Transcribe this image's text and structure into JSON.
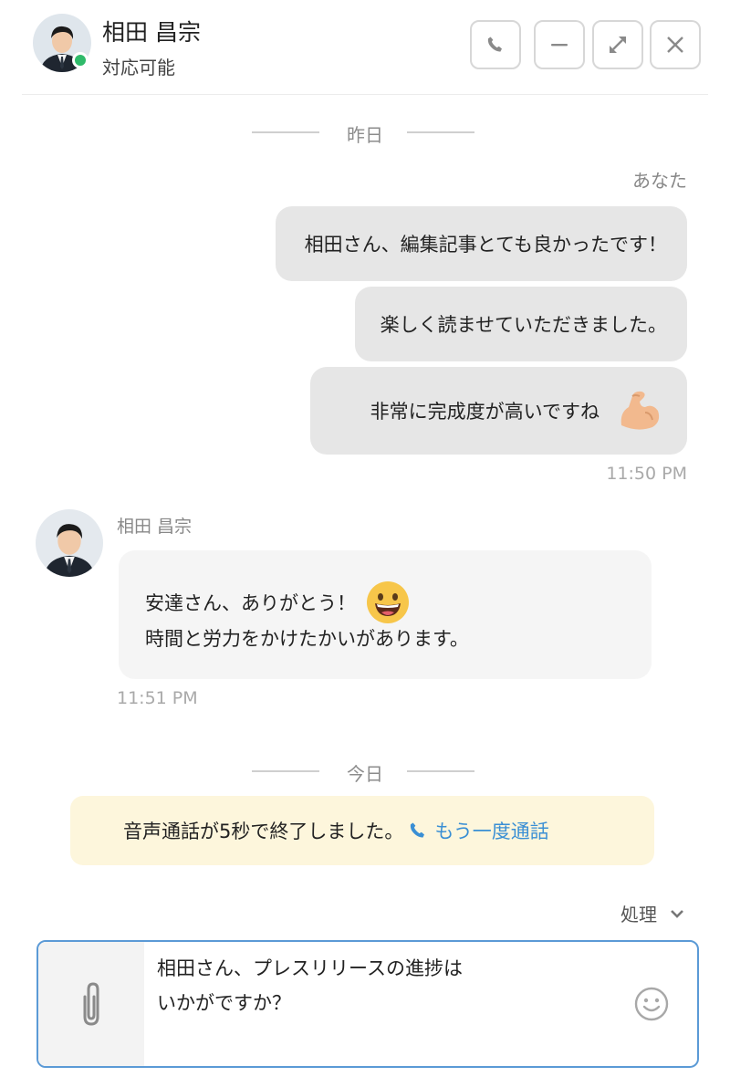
{
  "header": {
    "contact_name": "相田 昌宗",
    "contact_status": "対応可能",
    "buttons": [
      "phone-icon",
      "minimize-icon",
      "expand-icon",
      "close-icon"
    ],
    "status_color": "#2fba6a"
  },
  "separators": {
    "yesterday": "昨日",
    "today": "今日"
  },
  "outgoing": {
    "sender": "あなた",
    "messages": [
      "相田さん、編集記事とても良かったです！",
      "楽しく読ませていただきました。",
      "非常に完成度が高いですね"
    ],
    "time": "11:50 PM"
  },
  "incoming": {
    "sender": "相田 昌宗",
    "line1": "安達さん、ありがとう！",
    "line2": "時間と労力をかけたかいがあります。",
    "time": "11:51 PM"
  },
  "call_notice": {
    "text": "音声通話が5秒で終了しました。",
    "link": "もう一度通話",
    "bg": "#fdf6dc",
    "link_color": "#3a8fd4"
  },
  "action_dropdown": {
    "label": "処理"
  },
  "composer": {
    "line1": "相田さん、プレスリリースの進捗は",
    "line2": "いかがですか？",
    "border_color": "#5b9ad6"
  }
}
